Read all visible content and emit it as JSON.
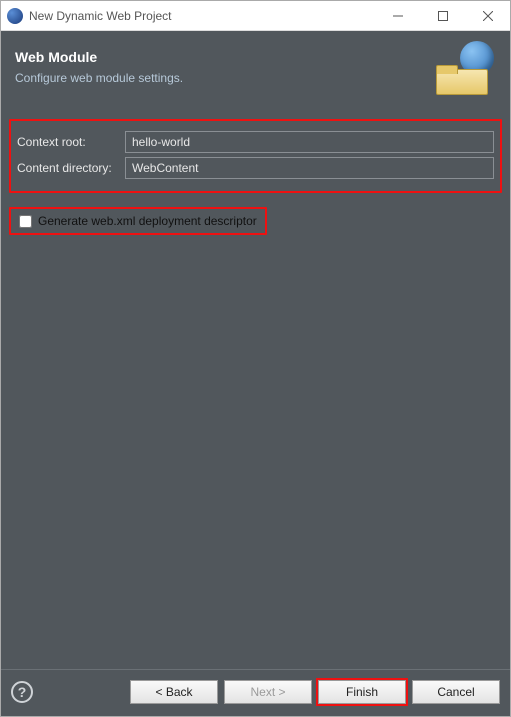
{
  "titlebar": {
    "title": "New Dynamic Web Project"
  },
  "header": {
    "title": "Web Module",
    "subtitle": "Configure web module settings."
  },
  "form": {
    "context_root_label": "Context root:",
    "context_root_value": "hello-world",
    "content_dir_label": "Content directory:",
    "content_dir_value": "WebContent",
    "generate_webxml_label": "Generate web.xml deployment descriptor"
  },
  "buttons": {
    "back": "< Back",
    "next": "Next >",
    "finish": "Finish",
    "cancel": "Cancel"
  }
}
